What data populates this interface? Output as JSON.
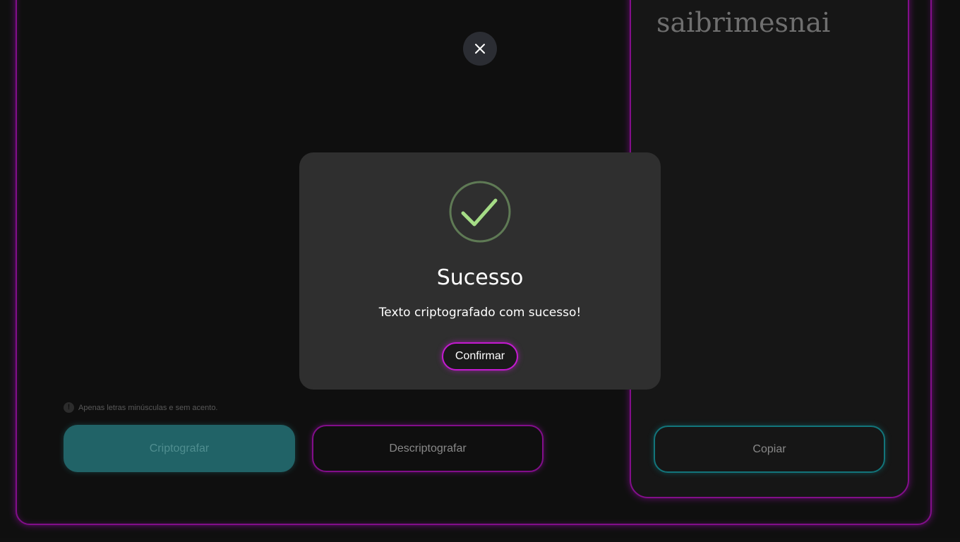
{
  "output": {
    "text": "saibrimesnai"
  },
  "input_area": {
    "hint_icon": "info-icon",
    "hint": "Apenas letras minúsculas e sem acento."
  },
  "buttons": {
    "encrypt_label": "Criptografar",
    "decrypt_label": "Descriptografar",
    "copy_label": "Copiar"
  },
  "modal": {
    "close_icon": "close-icon",
    "status_icon": "check-circle-icon",
    "title": "Sucesso",
    "message": "Texto criptografado com sucesso!",
    "confirm_label": "Confirmar"
  },
  "colors": {
    "accent_magenta": "#b414c0",
    "accent_teal": "#2e8a8f",
    "success_green": "#a5dc86",
    "modal_background": "#2f2f2f",
    "page_background": "#161616"
  }
}
